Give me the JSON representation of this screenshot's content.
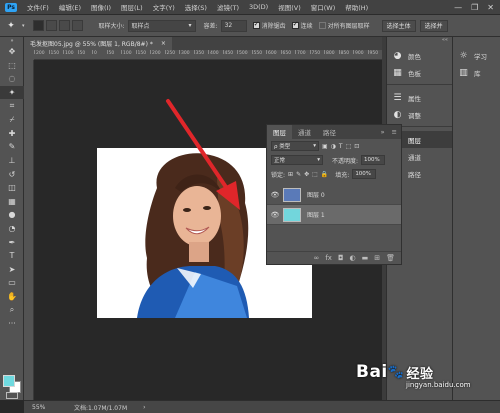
{
  "menu": {
    "logo": "Ps",
    "items": [
      "文件(F)",
      "编辑(E)",
      "图像(I)",
      "图层(L)",
      "文字(Y)",
      "选择(S)",
      "滤镜(T)",
      "3D(D)",
      "视图(V)",
      "窗口(W)",
      "帮助(H)"
    ],
    "window_controls": [
      "—",
      "❐",
      "✕"
    ]
  },
  "options_bar": {
    "tool_icon": "magic-wand-icon",
    "sample_size_label": "取样大小:",
    "sample_size_value": "取样点",
    "tolerance_label": "容差:",
    "tolerance_value": "32",
    "anti_alias_label": "消除锯齿",
    "contiguous_label": "连续",
    "sample_all_layers_label": "对所有图层取样",
    "select_subject_label": "选择主体",
    "select_mask_label": "选择并"
  },
  "document": {
    "tab_title": "毛发抠图05.jpg @ 55% (图层 1, RGB/8#) *",
    "close": "×"
  },
  "ruler": {
    "ticks": [
      "200",
      "150",
      "100",
      "50",
      "0",
      "50",
      "100",
      "150",
      "200",
      "250",
      "300",
      "350",
      "400",
      "450",
      "500",
      "550",
      "600",
      "650",
      "700",
      "750",
      "800",
      "850",
      "900",
      "950"
    ]
  },
  "statusbar": {
    "zoom": "55%",
    "doc_info": "文档:1.07M/1.07M",
    "arrow": "›"
  },
  "panel_strip": {
    "items": [
      {
        "icon": "color-icon",
        "label": "颜色"
      },
      {
        "icon": "swatches-icon",
        "label": "色板"
      },
      {
        "icon": "properties-icon",
        "label": "属性"
      },
      {
        "icon": "adjustments-icon",
        "label": "调整"
      },
      {
        "icon": "layers-icon",
        "label": "图层"
      },
      {
        "icon": "channels-icon",
        "label": "通道"
      },
      {
        "icon": "paths-icon",
        "label": "路径"
      }
    ]
  },
  "right_panel": {
    "items": [
      {
        "icon": "learn-icon",
        "label": "学习"
      },
      {
        "icon": "libraries-icon",
        "label": "库"
      }
    ]
  },
  "layers_panel": {
    "tabs": [
      "图层",
      "通道",
      "路径"
    ],
    "collapse": "»",
    "menu": "≡",
    "filter_label": "ρ 类型",
    "filter_icons": [
      "▣",
      "◑",
      "T",
      "⬚",
      "⊡"
    ],
    "blend_mode": "正常",
    "opacity_label": "不透明度:",
    "opacity_value": "100%",
    "lock_label": "锁定:",
    "lock_icons": [
      "⊞",
      "✎",
      "✥",
      "⬚",
      "🔒"
    ],
    "fill_label": "填充:",
    "fill_value": "100%",
    "layers": [
      {
        "name": "图层 0",
        "thumb_color": "#5a7ab8",
        "selected": false
      },
      {
        "name": "图层 1",
        "thumb_color": "#72d6dc",
        "selected": true
      }
    ],
    "footer_icons": [
      "∞",
      "fx",
      "◘",
      "◐",
      "▬",
      "⊞",
      "🗑"
    ]
  },
  "colors": {
    "foreground": "#6fd9df",
    "background": "#ffffff",
    "arrow": "#e0262a"
  },
  "watermark": {
    "brand": "Bai",
    "paw": "🐾",
    "brand_suffix": "经验",
    "url": "jingyan.baidu.com"
  }
}
